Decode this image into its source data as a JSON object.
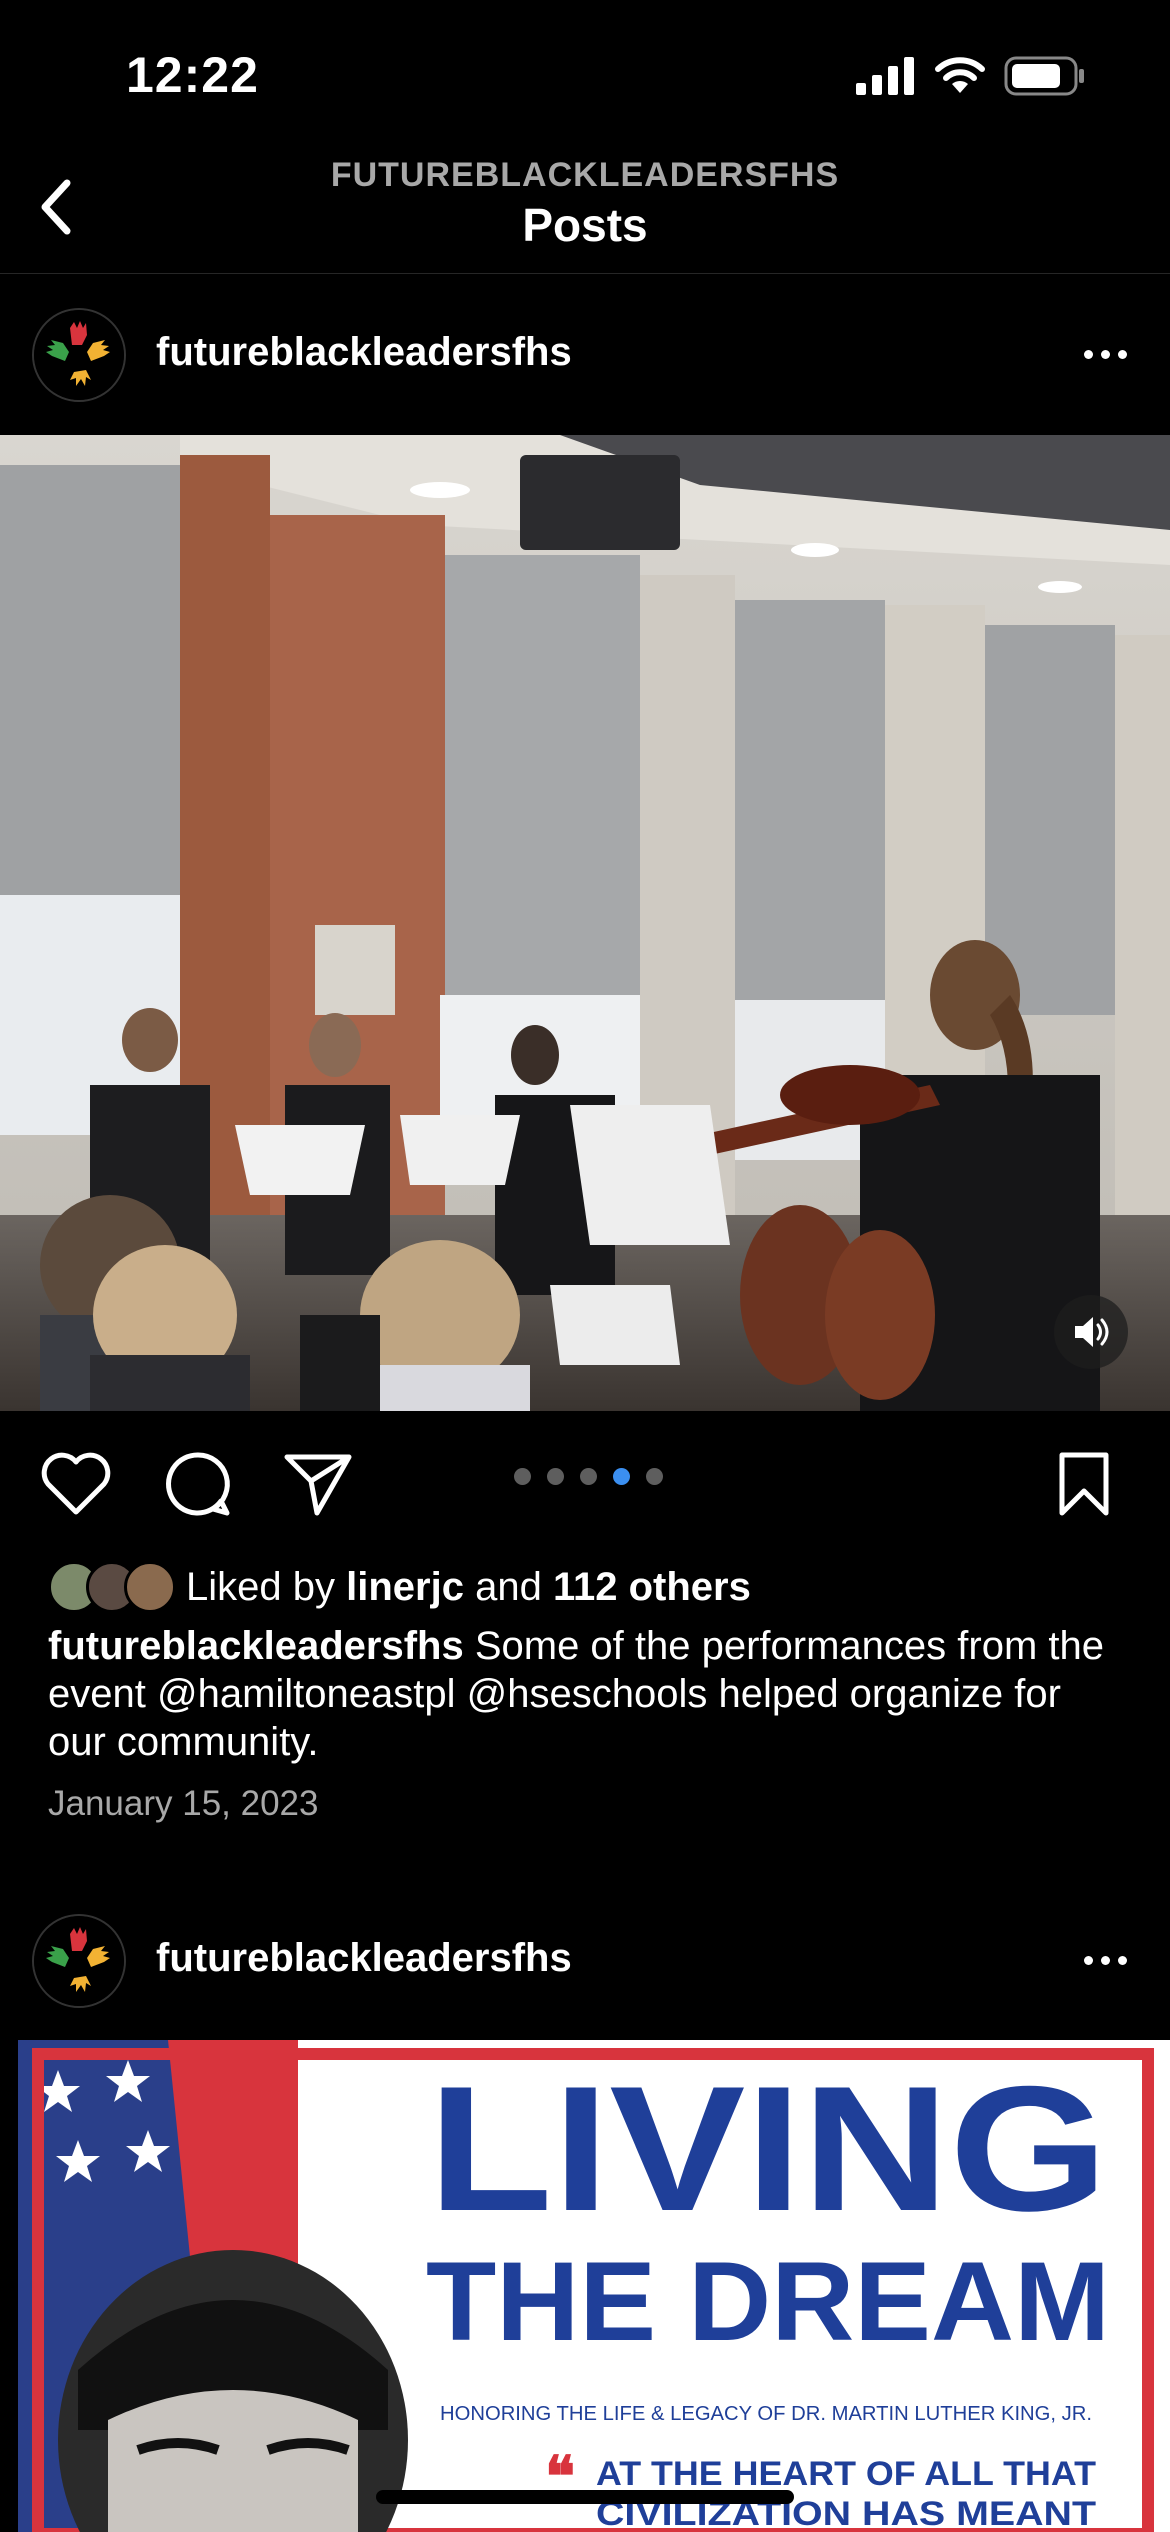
{
  "status_bar": {
    "time": "12:22"
  },
  "nav": {
    "account": "FUTUREBLACKLEADERSFHS",
    "title": "Posts"
  },
  "posts": [
    {
      "username": "futureblackleadersfhs",
      "likes": {
        "prefix": "Liked by",
        "user": "linerjc",
        "middle": "and",
        "others": "112 others"
      },
      "caption_user": "futureblackleadersfhs",
      "caption_text": " Some of the performances from the event @hamiltoneastpl  @hseschools helped organize for our community.",
      "date": "January 15, 2023",
      "carousel": {
        "count": 5,
        "active_index": 3
      }
    },
    {
      "username": "futureblackleadersfhs",
      "poster": {
        "line1": "LIVING",
        "line2": "THE DREAM",
        "subtitle": "HONORING THE LIFE & LEGACY OF DR. MARTIN LUTHER KING, JR.",
        "quote1": "AT THE HEART OF ALL THAT",
        "quote2": "CIVILIZATION HAS MEANT"
      }
    }
  ],
  "colors": {
    "accent": "#3b8ff0",
    "poster_blue": "#1f3f99",
    "poster_red": "#d8343d"
  },
  "icons": [
    "back-chevron-icon",
    "heart-icon",
    "comment-icon",
    "share-icon",
    "bookmark-icon",
    "sound-on-icon",
    "more-icon"
  ]
}
